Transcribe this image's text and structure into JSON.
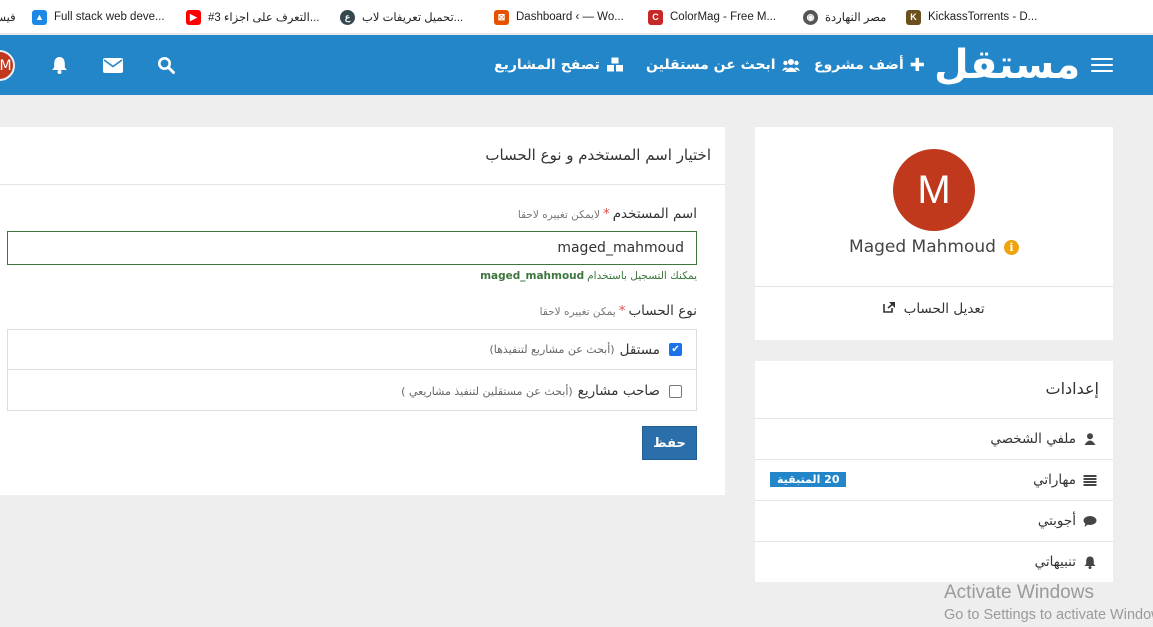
{
  "bookmarks": [
    {
      "label": "KickassTorrents - D...",
      "icon": "kickass-icon",
      "color": "#6b4f1d"
    },
    {
      "label": "مصر النهاردة",
      "icon": "globe-icon",
      "color": "#555555"
    },
    {
      "label": "ColorMag - Free M...",
      "icon": "colormag-icon",
      "color": "#c62828"
    },
    {
      "label": "Dashboard ‹ — Wo...",
      "icon": "dashboard-icon",
      "color": "#e65100"
    },
    {
      "label": "تحميل تعريفات لاب...",
      "icon": "site-icon",
      "color": "#37474f"
    },
    {
      "label": "#3 التعرف على اجزاء...",
      "icon": "youtube-icon",
      "color": "#ff0000"
    },
    {
      "label": "Full stack web deve...",
      "icon": "drive-icon",
      "color": "#1e88e5"
    },
    {
      "label": "فيس",
      "icon": "facebook-icon",
      "color": "#1877f2"
    }
  ],
  "navbar": {
    "logo": "مستقل",
    "add_project": "أضف مشروع",
    "find_freelancers": "ابحث عن مستقلين",
    "browse_projects": "تصفح المشاريع",
    "avatar_letter": "M"
  },
  "main": {
    "title": "اختيار اسم المستخدم و نوع الحساب",
    "username_label": "اسم المستخدم",
    "username_hint": "لايمكن تغييره لاحقا",
    "username_value": "maged_mahmoud",
    "username_help_prefix": "يمكنك التسجيل باستخدام",
    "username_help_value": "maged_mahmoud",
    "account_type_label": "نوع الحساب",
    "account_type_hint": "يمكن تغييره لاحقا",
    "options": [
      {
        "label": "مستقل",
        "desc": "(أبحث عن مشاريع لتنفيذها)",
        "checked": true
      },
      {
        "label": "صاحب مشاريع",
        "desc": "(أبحث عن مستقلين لتنفيذ مشاريعي )",
        "checked": false
      }
    ],
    "save_label": "حفظ",
    "required_mark": "*"
  },
  "profile": {
    "avatar_letter": "M",
    "name": "Maged Mahmoud",
    "edit_account": "تعديل الحساب"
  },
  "settings": {
    "title": "إعدادات",
    "items": [
      {
        "label": "ملفي الشخصي",
        "icon": "user-icon"
      },
      {
        "label": "مهاراتي",
        "icon": "list-icon",
        "badge": "20 المتبقية"
      },
      {
        "label": "أجوبتي",
        "icon": "comment-icon"
      },
      {
        "label": "تنبيهاتي",
        "icon": "bell-icon"
      }
    ]
  },
  "watermark": {
    "line1": "Activate Windows",
    "line2": "Go to Settings to activate Windows."
  },
  "colors": {
    "navbar": "#2386c8",
    "avatar": "#c0391c",
    "save_button": "#2a6eaa",
    "success_text": "#3c763d"
  }
}
